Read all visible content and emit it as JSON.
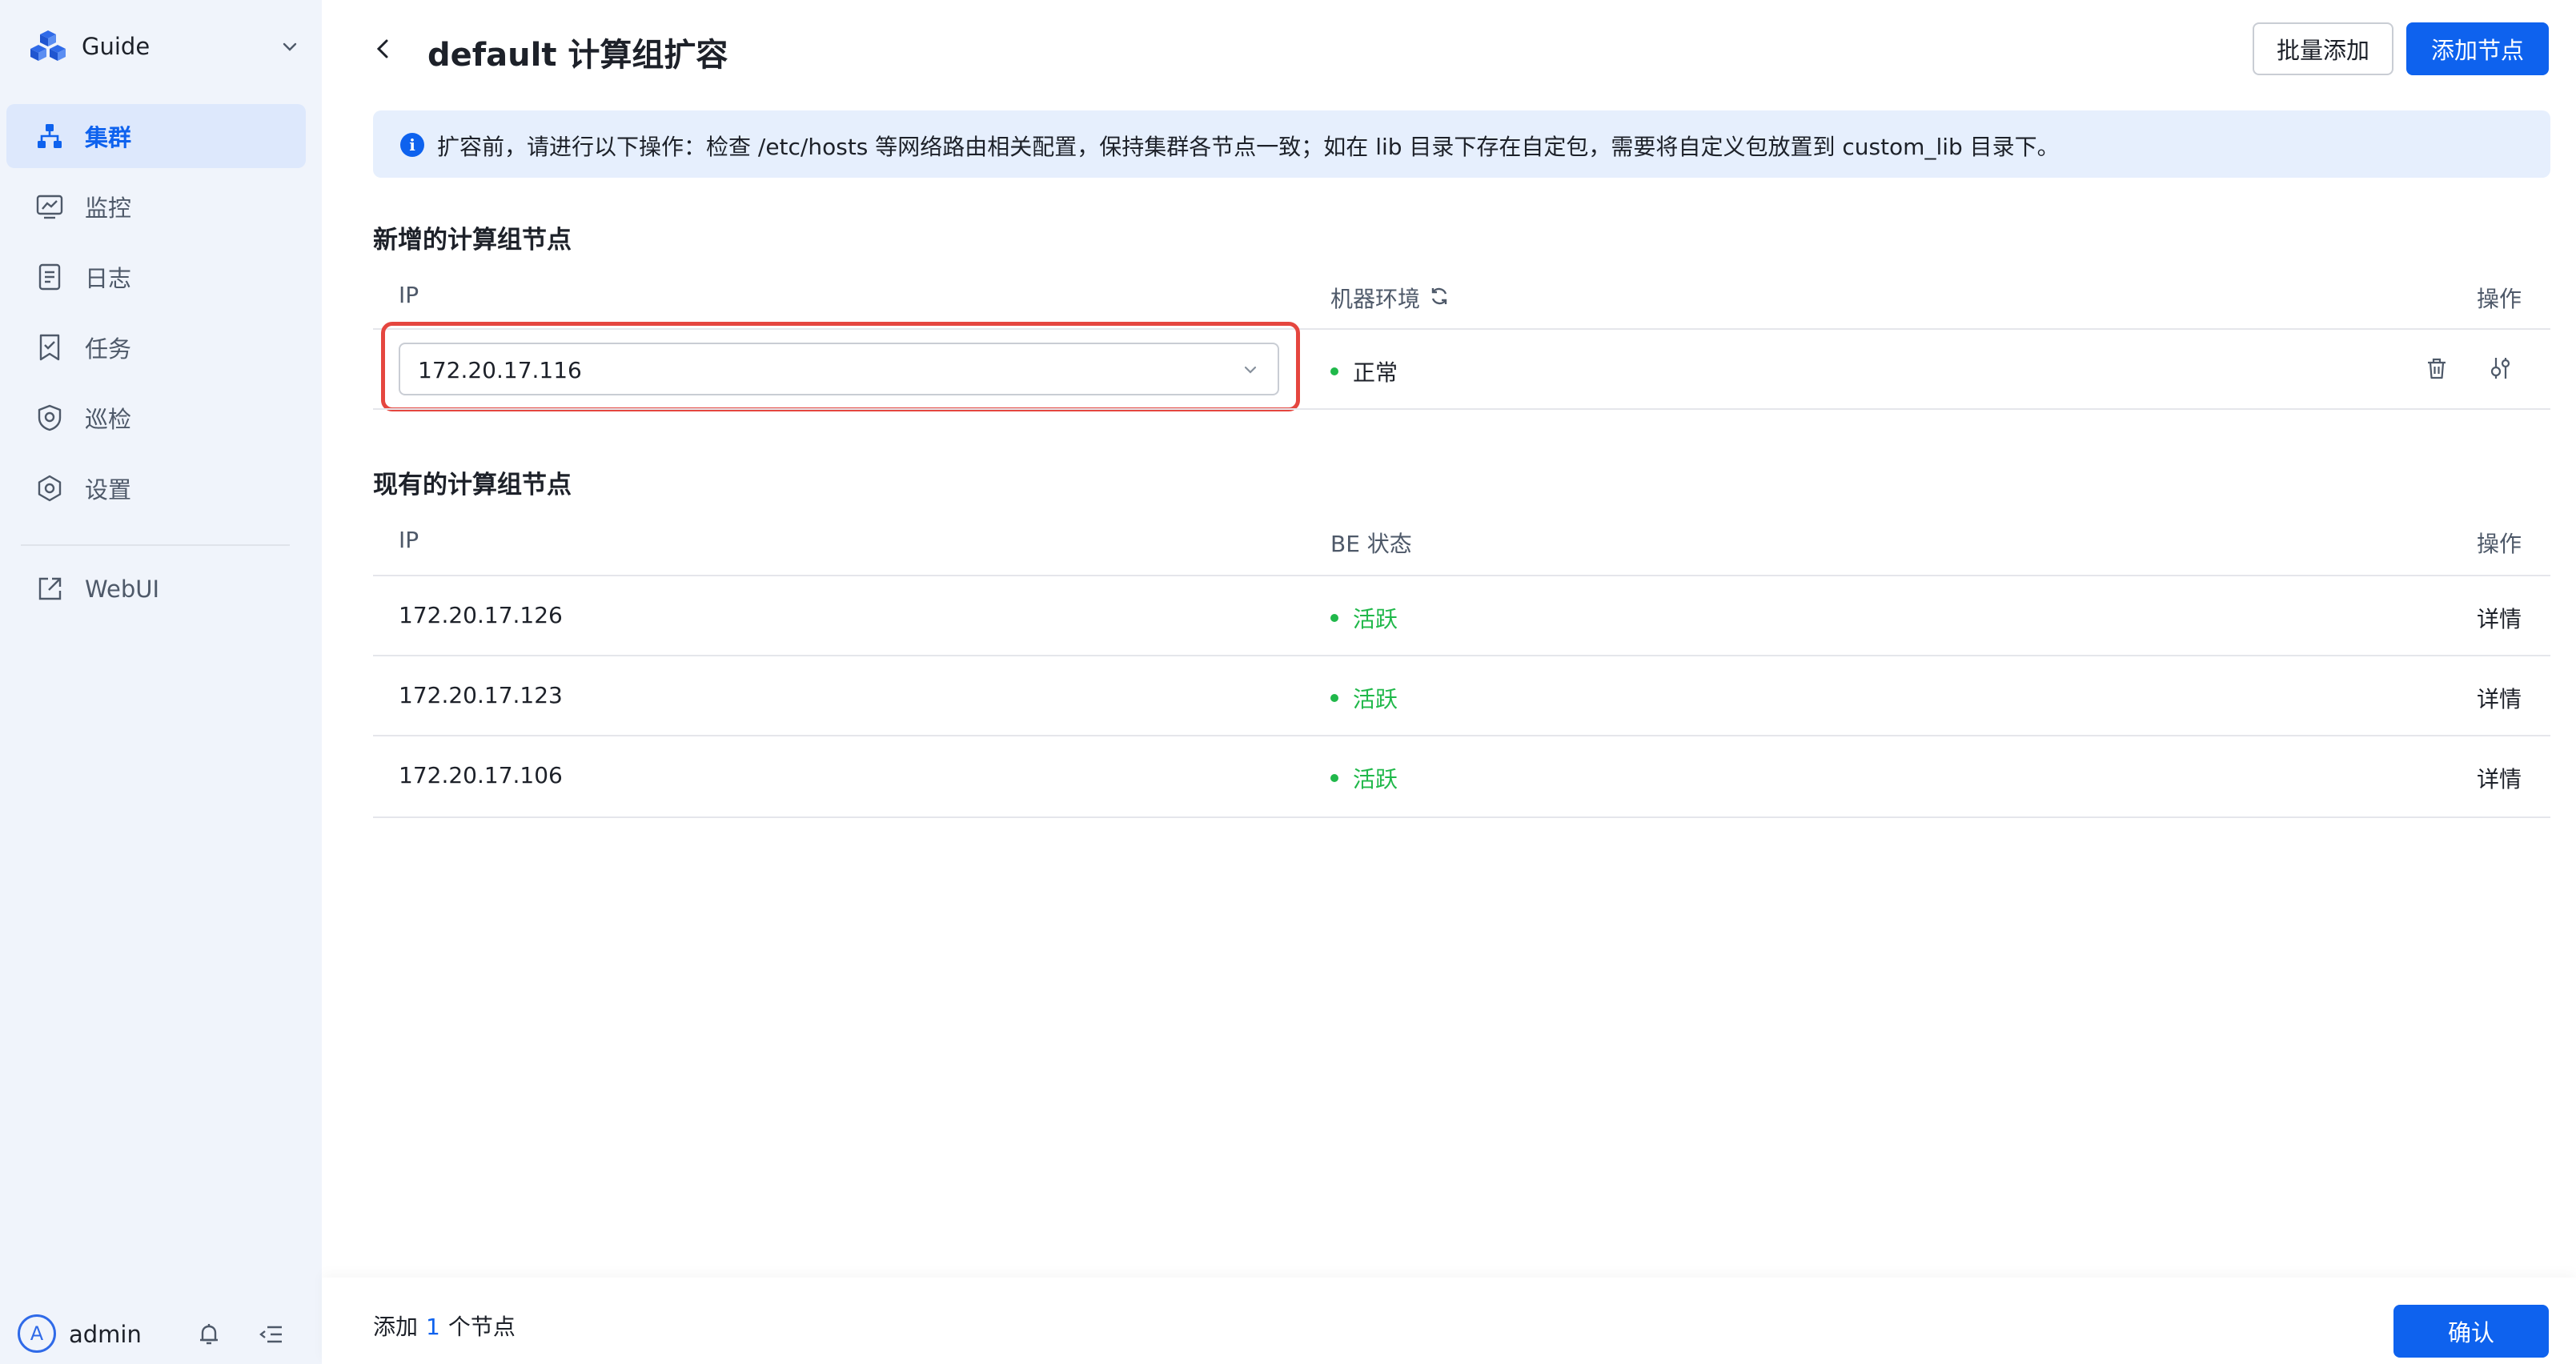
{
  "brand": {
    "name": "Guide"
  },
  "nav": [
    {
      "label": "集群",
      "icon": "cluster-icon",
      "active": true
    },
    {
      "label": "监控",
      "icon": "monitor-icon"
    },
    {
      "label": "日志",
      "icon": "log-icon"
    },
    {
      "label": "任务",
      "icon": "task-icon"
    },
    {
      "label": "巡检",
      "icon": "inspection-icon"
    },
    {
      "label": "设置",
      "icon": "settings-icon"
    }
  ],
  "external_link": {
    "label": "WebUI",
    "icon": "external-link-icon"
  },
  "user": {
    "avatar_initial": "A",
    "name": "admin"
  },
  "header": {
    "title": "default 计算组扩容",
    "batch_add_label": "批量添加",
    "add_node_label": "添加节点"
  },
  "alert": {
    "icon_glyph": "i",
    "text": "扩容前，请进行以下操作：检查 /etc/hosts 等网络路由相关配置，保持集群各节点一致；如在 lib 目录下存在自定包，需要将自定义包放置到 custom_lib 目录下。"
  },
  "new_nodes": {
    "title": "新增的计算组节点",
    "columns": {
      "ip": "IP",
      "env": "机器环境",
      "action": "操作"
    },
    "rows": [
      {
        "ip": "172.20.17.116",
        "env_status": "正常"
      }
    ]
  },
  "existing_nodes": {
    "title": "现有的计算组节点",
    "columns": {
      "ip": "IP",
      "status": "BE 状态",
      "action": "操作"
    },
    "rows": [
      {
        "ip": "172.20.17.126",
        "status": "活跃",
        "action": "详情"
      },
      {
        "ip": "172.20.17.123",
        "status": "活跃",
        "action": "详情"
      },
      {
        "ip": "172.20.17.106",
        "status": "活跃",
        "action": "详情"
      }
    ]
  },
  "footer": {
    "prefix": "添加",
    "count": "1",
    "suffix": "个节点",
    "confirm_label": "确认"
  },
  "colors": {
    "primary": "#0e62ee",
    "success": "#20b84a",
    "highlight": "#e5463f",
    "sidebar_bg": "#f0f4fb"
  }
}
